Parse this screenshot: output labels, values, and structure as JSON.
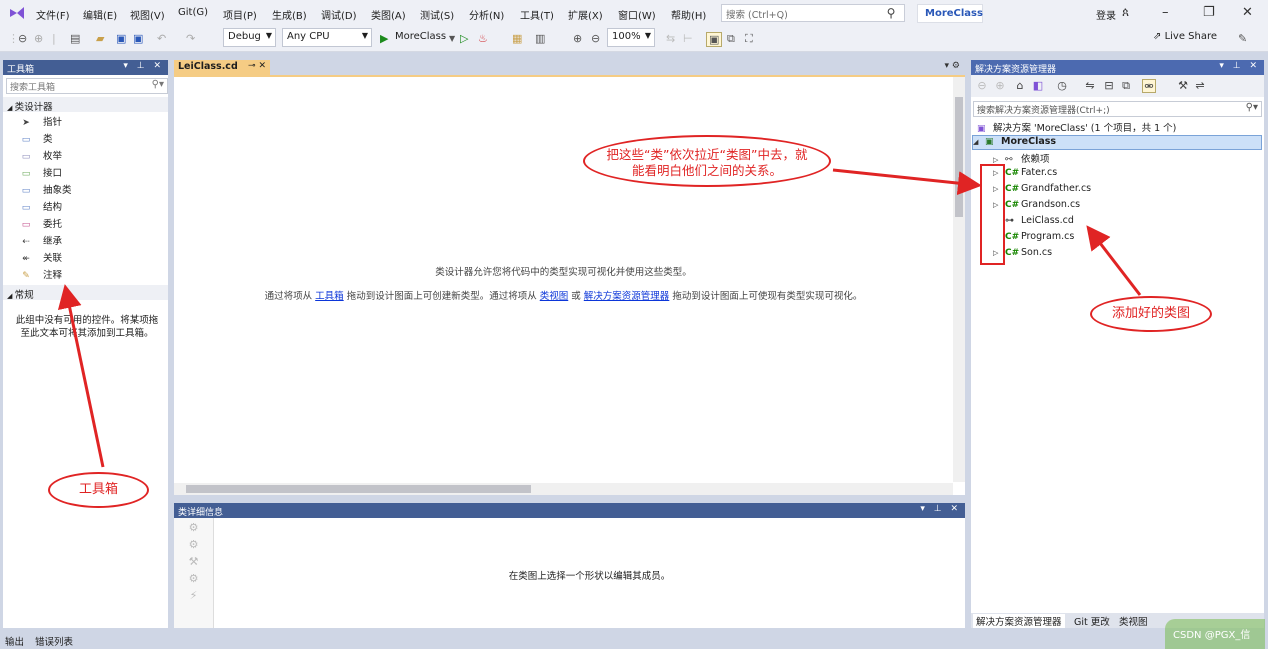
{
  "menu": [
    "文件(F)",
    "编辑(E)",
    "视图(V)",
    "Git(G)",
    "项目(P)",
    "生成(B)",
    "调试(D)",
    "类图(A)",
    "测试(S)",
    "分析(N)",
    "工具(T)",
    "扩展(X)",
    "窗口(W)",
    "帮助(H)"
  ],
  "search_placeholder": "搜索 (Ctrl+Q)",
  "solution_name": "MoreClass",
  "login": "登录",
  "toolbar": {
    "config": "Debug",
    "platform": "Any CPU",
    "run_label": "MoreClass",
    "zoom": "100%",
    "live_share": "Live Share"
  },
  "toolbox": {
    "title": "工具箱",
    "search": "搜索工具箱",
    "group1": "类设计器",
    "items": [
      "指针",
      "类",
      "枚举",
      "接口",
      "抽象类",
      "结构",
      "委托",
      "继承",
      "关联",
      "注释"
    ],
    "group2": "常规",
    "empty_text": "此组中没有可用的控件。将某项拖至此文本可将其添加到工具箱。"
  },
  "doc_tab": "LeiClass.cd",
  "editor": {
    "line1": "类设计器允许您将代码中的类型实现可视化并使用这些类型。",
    "line2_a": "通过将项从 ",
    "link1": "工具箱",
    "line2_b": " 拖动到设计图面上可创建新类型。通过将项从 ",
    "link2": "类视图",
    "line2_c": " 或 ",
    "link3": "解决方案资源管理器",
    "line2_d": " 拖动到设计图面上可使现有类型实现可视化。"
  },
  "details": {
    "title": "类详细信息",
    "message": "在类图上选择一个形状以编辑其成员。"
  },
  "solution_explorer": {
    "title": "解决方案资源管理器",
    "search": "搜索解决方案资源管理器(Ctrl+;)",
    "solution_line": "解决方案 'MoreClass' (1 个项目，共 1 个)",
    "project": "MoreClass",
    "deps": "依赖项",
    "files": [
      "Fater.cs",
      "Grandfather.cs",
      "Grandson.cs",
      "LeiClass.cd",
      "Program.cs",
      "Son.cs"
    ],
    "bottom_tabs": [
      "解决方案资源管理器",
      "Git 更改",
      "类视图"
    ]
  },
  "status": [
    "输出",
    "错误列表"
  ],
  "annotations": {
    "bubble_main": "把这些“类”依次拉近“类图”中去，就能看明白他们之间的关系。",
    "bubble_toolbox": "工具箱",
    "bubble_added": "添加好的类图"
  },
  "watermark": "CSDN @PGX_信",
  "colors": {
    "accent": "#4c6ab0",
    "tab": "#f5cc84",
    "annotation": "#e02424",
    "link": "#0c36d9"
  }
}
